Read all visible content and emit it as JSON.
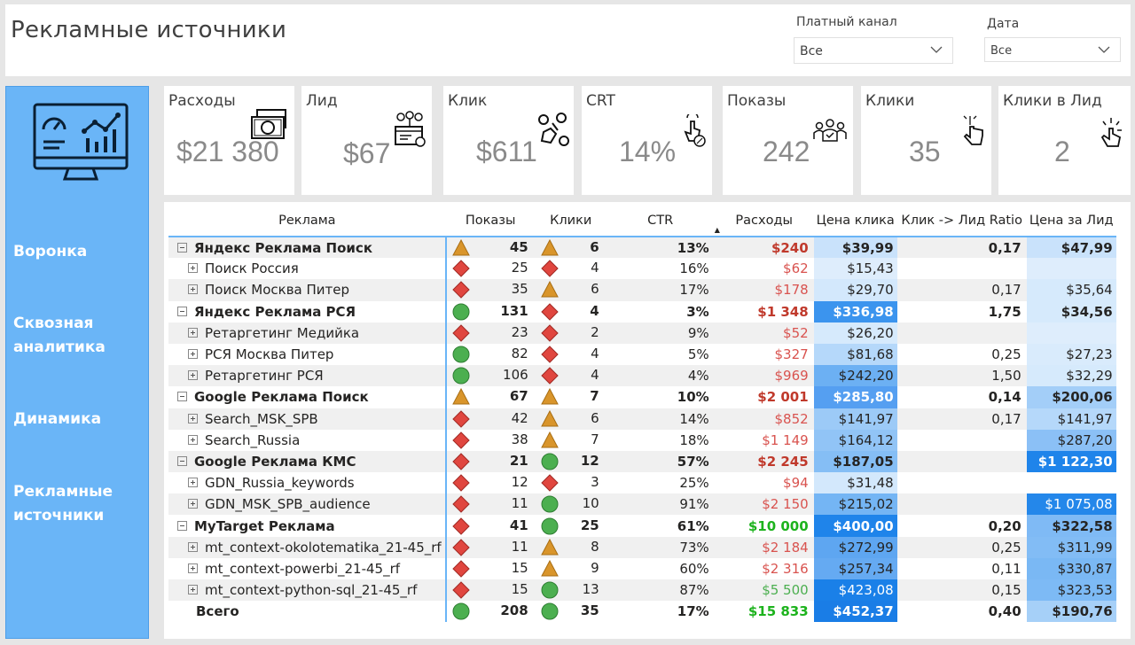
{
  "page": {
    "title": "Рекламные источники"
  },
  "filters": [
    {
      "label": "Платный канал",
      "value": "Все"
    },
    {
      "label": "Дата",
      "value": "Все"
    }
  ],
  "nav": [
    {
      "label": "Воронка"
    },
    {
      "label": "Сквозная аналитика"
    },
    {
      "label": "Динамика"
    },
    {
      "label": "Рекламные источники"
    }
  ],
  "kpis": [
    {
      "label": "Расходы",
      "value": "$21 380",
      "icon": "money-icon"
    },
    {
      "label": "Лид",
      "value": "$67",
      "icon": "lead-icon"
    },
    {
      "label": "Клик",
      "value": "$611",
      "icon": "click-cost-icon"
    },
    {
      "label": "CRT",
      "value": "14%",
      "icon": "touch-percent-icon"
    },
    {
      "label": "Показы",
      "value": "242",
      "icon": "audience-icon"
    },
    {
      "label": "Клики",
      "value": "35",
      "icon": "pointer-hand-icon"
    },
    {
      "label": "Клики в Лид",
      "value": "2",
      "icon": "tap-hand-icon"
    }
  ],
  "table": {
    "columns": [
      "Реклама",
      "Показы",
      "Клики",
      "CTR",
      "Расходы",
      "Цена клика",
      "Клик -> Лид Ratio",
      "Цена за Лид"
    ],
    "rows": [
      {
        "level": 0,
        "name": "Яндекс Реклама Поиск",
        "show_icon": "triangle",
        "shows": "45",
        "click_icon": "triangle",
        "clicks": "6",
        "ctr": "13%",
        "cost": "$240",
        "cost_color": "#c0392b",
        "cpc": "$39,99",
        "cpc_bg": "#c9e2fb",
        "ratio": "0,17",
        "cpl": "$47,99",
        "cpl_bg": "#c9e2fb"
      },
      {
        "level": 1,
        "name": "Поиск Россия",
        "show_icon": "diamond",
        "shows": "25",
        "click_icon": "diamond",
        "clicks": "4",
        "ctr": "16%",
        "cost": "$62",
        "cost_color": "#d9534f",
        "cpc": "$15,43",
        "cpc_bg": "#deedfc",
        "ratio": "",
        "cpl": "",
        "cpl_bg": "#deedfc"
      },
      {
        "level": 1,
        "name": "Поиск Москва Питер",
        "show_icon": "diamond",
        "shows": "35",
        "click_icon": "triangle",
        "clicks": "6",
        "ctr": "17%",
        "cost": "$178",
        "cost_color": "#d9534f",
        "cpc": "$29,70",
        "cpc_bg": "#d3e8fc",
        "ratio": "0,17",
        "cpl": "$35,64",
        "cpl_bg": "#d6eafc"
      },
      {
        "level": 0,
        "name": "Яндекс Реклама РСЯ",
        "show_icon": "circle",
        "shows": "131",
        "click_icon": "diamond",
        "clicks": "4",
        "ctr": "3%",
        "cost": "$1 348",
        "cost_color": "#c0392b",
        "cpc": "$336,98",
        "cpc_bg": "#3b94ee",
        "ratio": "1,75",
        "cpl": "$34,56",
        "cpl_bg": "#d6eafc"
      },
      {
        "level": 1,
        "name": "Ретаргетинг Медийка",
        "show_icon": "diamond",
        "shows": "23",
        "click_icon": "diamond",
        "clicks": "2",
        "ctr": "9%",
        "cost": "$52",
        "cost_color": "#d9534f",
        "cpc": "$26,20",
        "cpc_bg": "#d6eafc",
        "ratio": "",
        "cpl": "",
        "cpl_bg": "#deedfc"
      },
      {
        "level": 1,
        "name": "РСЯ Москва Питер",
        "show_icon": "circle",
        "shows": "82",
        "click_icon": "diamond",
        "clicks": "4",
        "ctr": "5%",
        "cost": "$327",
        "cost_color": "#d9534f",
        "cpc": "$81,68",
        "cpc_bg": "#b5d8fa",
        "ratio": "0,25",
        "cpl": "$27,23",
        "cpl_bg": "#d9ebfc"
      },
      {
        "level": 1,
        "name": "Ретаргетинг РСЯ",
        "show_icon": "circle",
        "shows": "106",
        "click_icon": "diamond",
        "clicks": "4",
        "ctr": "4%",
        "cost": "$969",
        "cost_color": "#d9534f",
        "cpc": "$242,20",
        "cpc_bg": "#6cb0f3",
        "ratio": "1,50",
        "cpl": "$32,29",
        "cpl_bg": "#d6eafc"
      },
      {
        "level": 0,
        "name": "Google Реклама Поиск",
        "show_icon": "triangle",
        "shows": "67",
        "click_icon": "triangle",
        "clicks": "7",
        "ctr": "10%",
        "cost": "$2 001",
        "cost_color": "#c0392b",
        "cpc": "$285,80",
        "cpc_bg": "#559ff1",
        "ratio": "0,14",
        "cpl": "$200,06",
        "cpl_bg": "#a3cef8"
      },
      {
        "level": 1,
        "name": "Search_MSK_SPB",
        "show_icon": "diamond",
        "shows": "42",
        "click_icon": "triangle",
        "clicks": "6",
        "ctr": "14%",
        "cost": "$852",
        "cost_color": "#d9534f",
        "cpc": "$141,97",
        "cpc_bg": "#9ccaf7",
        "ratio": "0,17",
        "cpl": "$141,97",
        "cpl_bg": "#b5d8fa"
      },
      {
        "level": 1,
        "name": "Search_Russia",
        "show_icon": "diamond",
        "shows": "38",
        "click_icon": "triangle",
        "clicks": "7",
        "ctr": "18%",
        "cost": "$1 149",
        "cost_color": "#d9534f",
        "cpc": "$164,12",
        "cpc_bg": "#91c4f6",
        "ratio": "",
        "cpl": "$287,20",
        "cpl_bg": "#8bc0f6"
      },
      {
        "level": 0,
        "name": "Google Реклама КМС",
        "show_icon": "diamond",
        "shows": "21",
        "click_icon": "circle",
        "clicks": "12",
        "ctr": "57%",
        "cost": "$2 245",
        "cost_color": "#c0392b",
        "cpc": "$187,05",
        "cpc_bg": "#85bef5",
        "ratio": "",
        "cpl": "$1 122,30",
        "cpl_bg": "#1f84ea"
      },
      {
        "level": 1,
        "name": "GDN_Russia_keywords",
        "show_icon": "diamond",
        "shows": "12",
        "click_icon": "diamond",
        "clicks": "3",
        "ctr": "25%",
        "cost": "$94",
        "cost_color": "#d9534f",
        "cpc": "$31,48",
        "cpc_bg": "#d3e8fc",
        "ratio": "",
        "cpl": "",
        "cpl_bg": "#ffffff"
      },
      {
        "level": 1,
        "name": "GDN_MSK_SPB_audience",
        "show_icon": "diamond",
        "shows": "11",
        "click_icon": "circle",
        "clicks": "10",
        "ctr": "91%",
        "cost": "$2 150",
        "cost_color": "#d9534f",
        "cpc": "$215,02",
        "cpc_bg": "#74b5f4",
        "ratio": "",
        "cpl": "$1 075,08",
        "cpl_bg": "#2487ea"
      },
      {
        "level": 0,
        "name": "MyTarget Реклама",
        "show_icon": "diamond",
        "shows": "41",
        "click_icon": "circle",
        "clicks": "25",
        "ctr": "61%",
        "cost": "$10 000",
        "cost_color": "#1db31d",
        "cpc": "$400,00",
        "cpc_bg": "#1f84ea",
        "ratio": "0,20",
        "cpl": "$322,58",
        "cpl_bg": "#7fbaf5"
      },
      {
        "level": 1,
        "name": "mt_context-okolotematika_21-45_rf",
        "show_icon": "diamond",
        "shows": "11",
        "click_icon": "triangle",
        "clicks": "8",
        "ctr": "73%",
        "cost": "$2 184",
        "cost_color": "#d9534f",
        "cpc": "$272,99",
        "cpc_bg": "#5ea6f1",
        "ratio": "0,25",
        "cpl": "$311,99",
        "cpl_bg": "#82bcf5"
      },
      {
        "level": 1,
        "name": "mt_context-powerbi_21-45_rf",
        "show_icon": "diamond",
        "shows": "15",
        "click_icon": "triangle",
        "clicks": "9",
        "ctr": "60%",
        "cost": "$2 316",
        "cost_color": "#d9534f",
        "cpc": "$257,34",
        "cpc_bg": "#65aaf2",
        "ratio": "0,11",
        "cpl": "$330,87",
        "cpl_bg": "#7ab8f4"
      },
      {
        "level": 1,
        "name": "mt_context-python-sql_21-45_rf",
        "show_icon": "diamond",
        "shows": "15",
        "click_icon": "circle",
        "clicks": "13",
        "ctr": "87%",
        "cost": "$5 500",
        "cost_color": "#4caf50",
        "cpc": "$423,08",
        "cpc_bg": "#1a80e8",
        "ratio": "0,15",
        "cpl": "$323,53",
        "cpl_bg": "#7dbaf5"
      },
      {
        "level": 2,
        "name": "Всего",
        "show_icon": "circle",
        "shows": "208",
        "click_icon": "circle",
        "clicks": "35",
        "ctr": "17%",
        "cost": "$15 833",
        "cost_color": "#1db31d",
        "cpc": "$452,37",
        "cpc_bg": "#1a7de6",
        "ratio": "0,40",
        "cpl": "$190,76",
        "cpl_bg": "#a6d0f8"
      }
    ]
  },
  "colors": {
    "accent": "#6ab5f7",
    "triangle": "#d9952b",
    "diamond": "#e0463f",
    "circle": "#4caf50"
  }
}
